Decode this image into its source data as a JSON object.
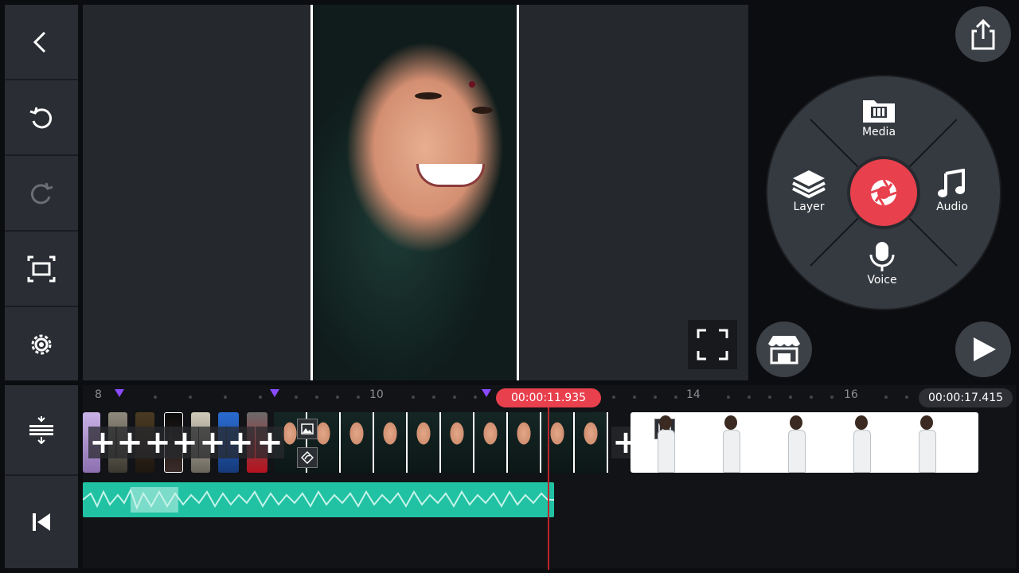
{
  "toolbar": {
    "back_icon": "back-arrow-icon",
    "undo_icon": "undo-icon",
    "redo_icon": "redo-icon",
    "crop_icon": "crop-frame-icon",
    "settings_icon": "settings-gear-icon",
    "split_icon": "split-timeline-icon",
    "skip_start_icon": "skip-to-start-icon"
  },
  "wheel": {
    "media_label": "Media",
    "layer_label": "Layer",
    "audio_label": "Audio",
    "voice_label": "Voice"
  },
  "timeline": {
    "current_time": "00:00:11.935",
    "total_time": "00:00:17.415",
    "ruler_labels": [
      "8",
      "10",
      "14",
      "16"
    ]
  },
  "colors": {
    "accent": "#e8404d",
    "audio": "#20c2a3",
    "panel": "#2a2d33",
    "marker": "#8a4bff"
  }
}
